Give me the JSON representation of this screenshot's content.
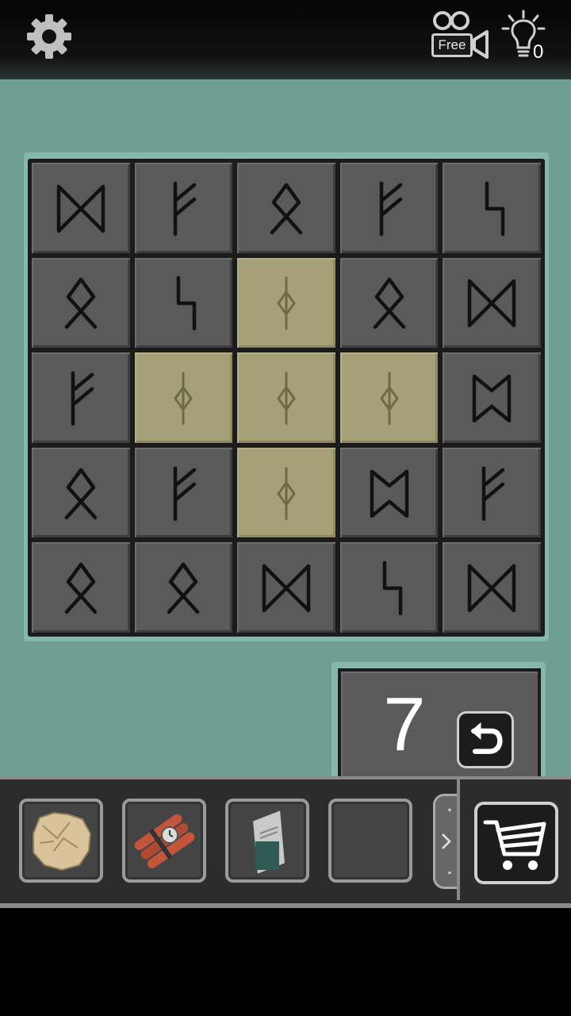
{
  "header": {
    "settings_icon": "gear-icon",
    "video_button_label": "Free",
    "video_icon": "video-camera-icon",
    "hint_icon": "lightbulb-icon",
    "hint_count": "0"
  },
  "board": {
    "rows": 5,
    "cols": 5,
    "tiles": [
      {
        "rune": "dagaz",
        "lit": false
      },
      {
        "rune": "fehu",
        "lit": false
      },
      {
        "rune": "othala",
        "lit": false
      },
      {
        "rune": "fehu",
        "lit": false
      },
      {
        "rune": "sowilo",
        "lit": false
      },
      {
        "rune": "othala",
        "lit": false
      },
      {
        "rune": "sowilo",
        "lit": false
      },
      {
        "rune": "ing",
        "lit": true
      },
      {
        "rune": "othala",
        "lit": false
      },
      {
        "rune": "dagaz",
        "lit": false
      },
      {
        "rune": "fehu",
        "lit": false
      },
      {
        "rune": "ing",
        "lit": true
      },
      {
        "rune": "ing",
        "lit": true
      },
      {
        "rune": "ing",
        "lit": true
      },
      {
        "rune": "perthro",
        "lit": false
      },
      {
        "rune": "othala",
        "lit": false
      },
      {
        "rune": "fehu",
        "lit": false
      },
      {
        "rune": "ing",
        "lit": true
      },
      {
        "rune": "perthro",
        "lit": false
      },
      {
        "rune": "fehu",
        "lit": false
      },
      {
        "rune": "othala",
        "lit": false
      },
      {
        "rune": "othala",
        "lit": false
      },
      {
        "rune": "dagaz",
        "lit": false
      },
      {
        "rune": "sowilo",
        "lit": false
      },
      {
        "rune": "dagaz",
        "lit": false
      }
    ]
  },
  "counter": {
    "value": "7",
    "reset_icon": "undo-arrow-icon"
  },
  "inventory": {
    "items": [
      {
        "name": "crumpled-paper-icon"
      },
      {
        "name": "dynamite-icon"
      },
      {
        "name": "folded-note-icon"
      },
      {
        "name": "empty-slot"
      }
    ],
    "scroll_icon": "chevron-right-icon",
    "cart_icon": "shopping-cart-icon"
  },
  "colors": {
    "background": "#6f9e93",
    "tile": "#5a5a5a",
    "tile_lit": "#a5a078"
  }
}
